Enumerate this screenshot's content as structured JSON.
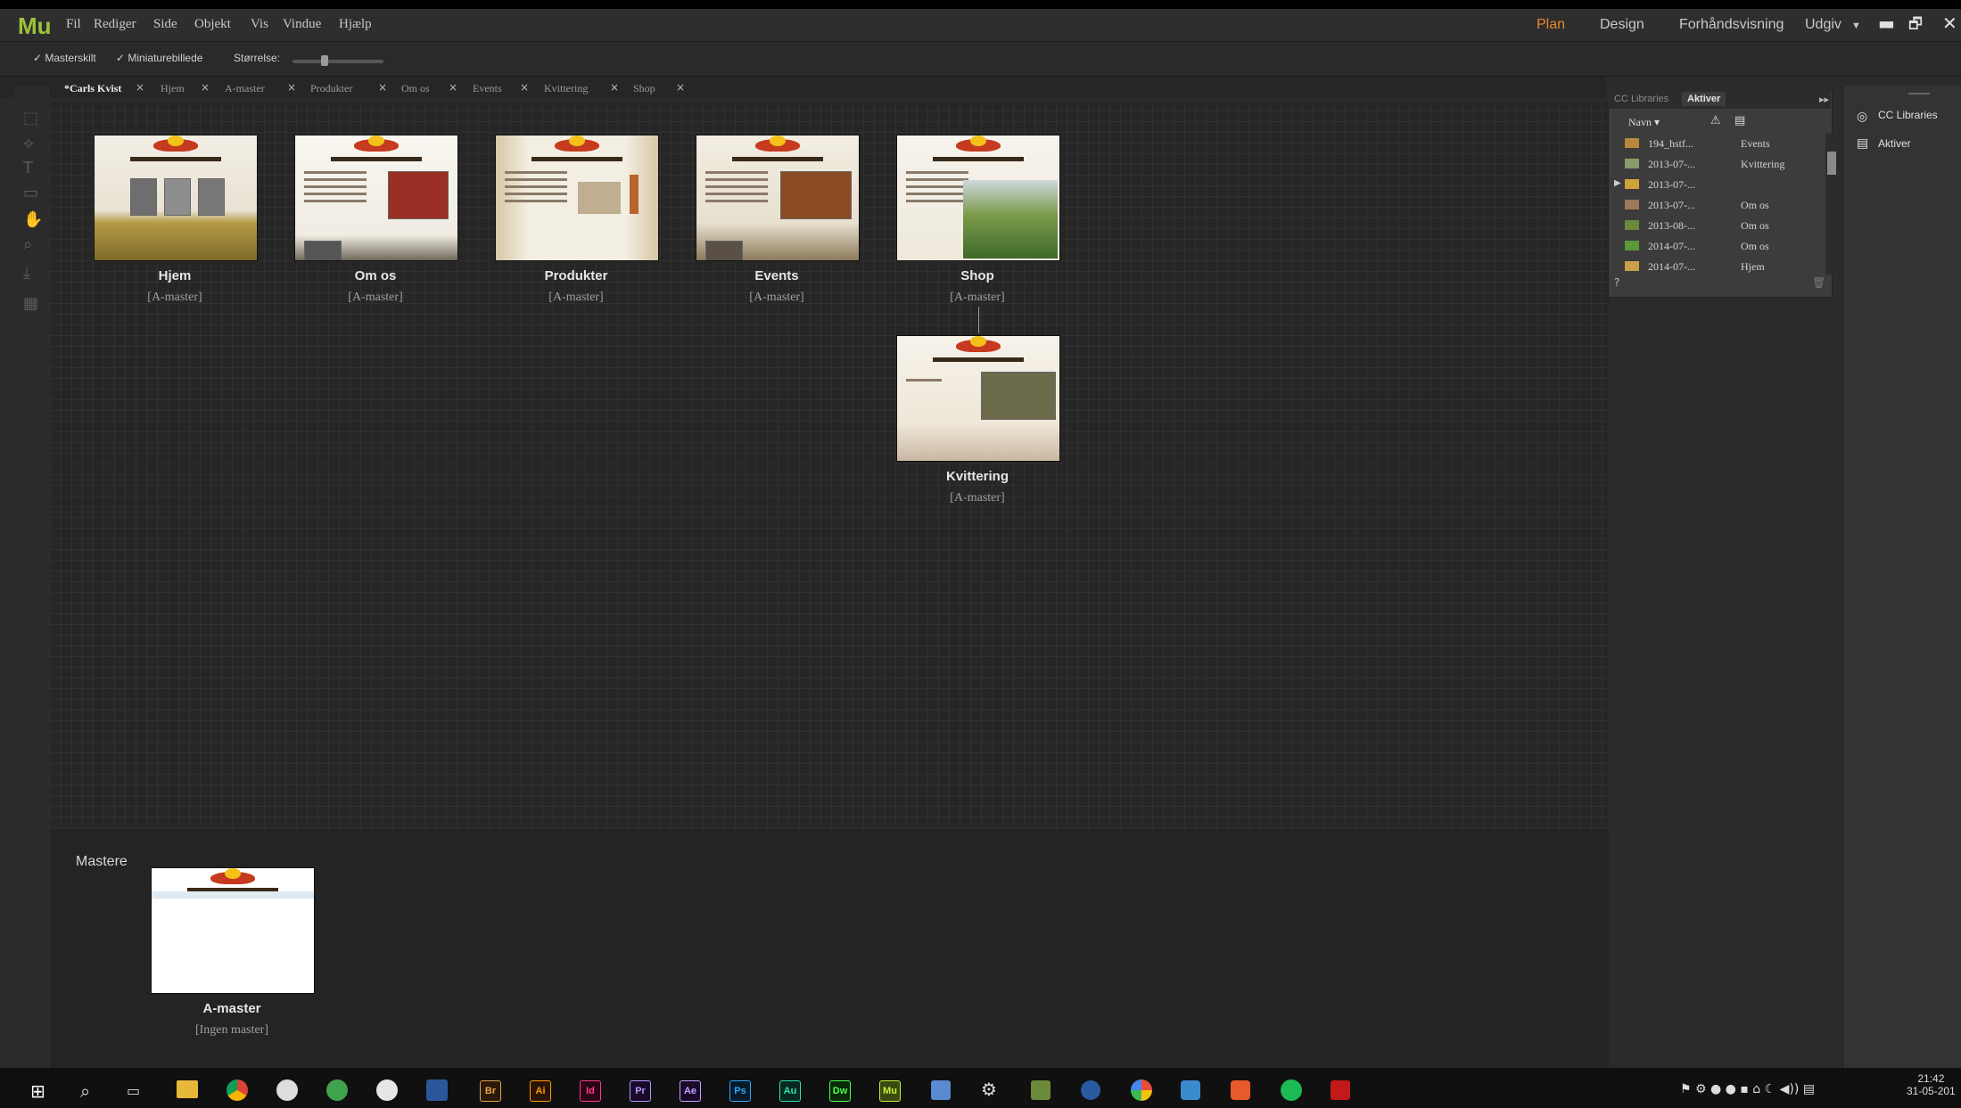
{
  "app": {
    "logo": "Mu"
  },
  "menu": [
    "Fil",
    "Rediger",
    "Side",
    "Objekt",
    "Vis",
    "Vindue",
    "Hjælp"
  ],
  "modes": {
    "plan": "Plan",
    "design": "Design",
    "preview": "Forhåndsvisning",
    "publish": "Udgiv"
  },
  "window_controls": {
    "minimize": "▬",
    "restore": "🗗",
    "close": "✕"
  },
  "options": {
    "masterskilt": "✓ Masterskilt",
    "miniature": "✓ Miniaturebillede",
    "size_label": "Størrelse:"
  },
  "tabs": [
    {
      "label": "*Carls Kvist",
      "active": true
    },
    {
      "label": "Hjem"
    },
    {
      "label": "A-master"
    },
    {
      "label": "Produkter"
    },
    {
      "label": "Om os"
    },
    {
      "label": "Events"
    },
    {
      "label": "Kvittering"
    },
    {
      "label": "Shop"
    }
  ],
  "tab_close": "×",
  "pages": [
    {
      "title": "Hjem",
      "master": "[A-master]"
    },
    {
      "title": "Om os",
      "master": "[A-master]"
    },
    {
      "title": "Produkter",
      "master": "[A-master]"
    },
    {
      "title": "Events",
      "master": "[A-master]"
    },
    {
      "title": "Shop",
      "master": "[A-master]"
    },
    {
      "title": "Kvittering",
      "master": "[A-master]"
    }
  ],
  "masters": {
    "label": "Mastere",
    "items": [
      {
        "title": "A-master",
        "master": "[Ingen master]"
      }
    ]
  },
  "assets_panel": {
    "tabs": [
      "CC Libraries",
      "Aktiver"
    ],
    "header_name": "Navn ▾",
    "rows": [
      {
        "name": "194_hstf...",
        "page": "Events"
      },
      {
        "name": "2013-07-...",
        "page": "Kvittering"
      },
      {
        "name": "2013-07-...",
        "page": ""
      },
      {
        "name": "2013-07-...",
        "page": "Om os"
      },
      {
        "name": "2013-08-...",
        "page": "Om os"
      },
      {
        "name": "2014-07-...",
        "page": "Om os"
      },
      {
        "name": "2014-07-...",
        "page": "Hjem"
      }
    ]
  },
  "dock": {
    "cc_libraries": "CC Libraries",
    "aktiver": "Aktiver"
  },
  "taskbar": {
    "apps": [
      "Br",
      "Ai",
      "Id",
      "Pr",
      "Ae",
      "Ps",
      "Au",
      "Dw",
      "Mu"
    ],
    "time": "21:42",
    "date": "31-05-201"
  },
  "colors": {
    "accent_orange": "#e8892b",
    "mu_green": "#9bc43a",
    "canvas_bg": "#262626"
  }
}
